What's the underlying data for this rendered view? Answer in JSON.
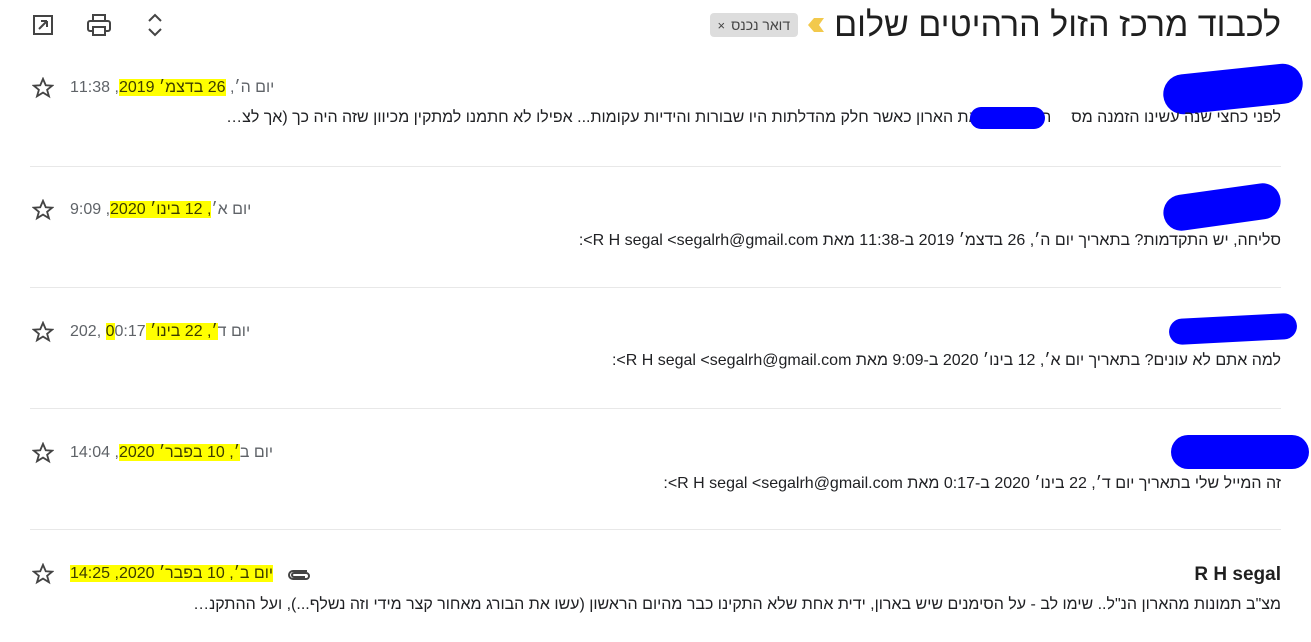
{
  "toolbar": {
    "icons": [
      "open-in-new-window-icon",
      "print-icon",
      "expand-collapse-icon"
    ]
  },
  "thread": {
    "subject": "לכבוד מרכז הזול הרהיטים שלום",
    "label": "דואר נכנס",
    "label_remove": "×"
  },
  "colors": {
    "highlight": "#ffff00",
    "redaction": "#0000ff",
    "chip_bg": "#dddddd",
    "importance": "#f2c94c"
  },
  "messages": [
    {
      "sender": "",
      "date_pre": "יום ה׳, ",
      "date_hl": "26 בדצמ׳ 2019",
      "date_post": ", 11:38",
      "snippet_a": "לפני כחצי שנה עשינו הזמנה מס",
      "snippet_b": "התקינו לנו את הארון כאשר חלק מהדלתות היו שבורות והידיות עקומות... אפילו לא חתמנו למתקין מכיוון שזה היה כך (אך לצ…"
    },
    {
      "sender": "",
      "date_pre": "יום א׳",
      "date_hl": ", 12 בינו׳ 2020",
      "date_post": ", 9:09",
      "snippet": "סליחה, יש התקדמות? בתאריך יום ה׳, 26 בדצמ׳ 2019 ב-11:38 מאת R H segal <segalrh@gmail.com>:"
    },
    {
      "sender": "",
      "date_pre": "יום ד",
      "date_hl": "׳, 22 בינו׳ 0",
      "date_post": "0:17 ,202",
      "snippet": "למה אתם לא עונים? בתאריך יום א׳, 12 בינו׳ 2020 ב-9:09 מאת R H segal <segalrh@gmail.com>:"
    },
    {
      "sender": "",
      "date_pre": "יום ב",
      "date_hl": "׳, 10 בפבר׳ 2020",
      "date_post": ", 14:04",
      "snippet": "זה המייל שלי בתאריך יום ד׳, 22 בינו׳ 2020 ב-0:17 מאת R H segal <segalrh@gmail.com>:"
    },
    {
      "sender": "R H segal",
      "date_pre": "",
      "date_hl": "יום ב׳, 10 בפבר׳ 2020, 14:25",
      "date_post": "",
      "snippet": "מצ\"ב תמונות מהארון הנ\"ל.. שימו לב - על הסימנים שיש בארון, ידית אחת שלא התקינו כבר מהיום הראשון (עשו את הבורג מאחור קצר מידי וזה נשלף...), ועל ההתקנ…"
    }
  ]
}
